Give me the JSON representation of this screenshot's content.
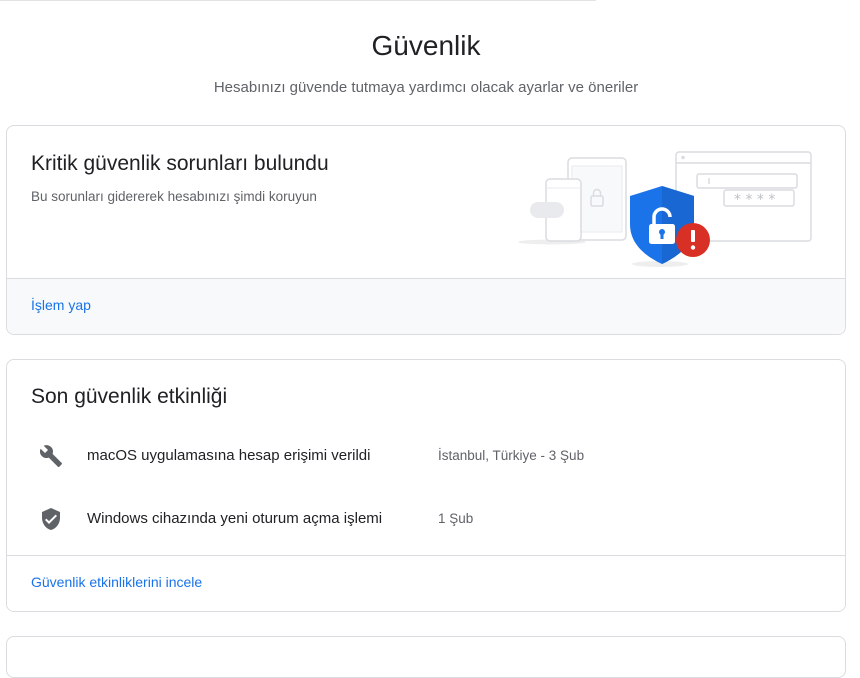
{
  "page": {
    "title": "Güvenlik",
    "subtitle": "Hesabınızı güvende tutmaya yardımcı olacak ayarlar ve öneriler"
  },
  "critical_card": {
    "title": "Kritik güvenlik sorunları bulundu",
    "description": "Bu sorunları gidererek hesabınızı şimdi koruyun",
    "action_link": "İşlem yap",
    "alert_color": "#d93025",
    "shield_color": "#1a73e8"
  },
  "activity_card": {
    "title": "Son güvenlik etkinliği",
    "events": [
      {
        "icon": "wrench-icon",
        "text": "macOS uygulamasına hesap erişimi verildi",
        "meta": "İstanbul, Türkiye - 3 Şub"
      },
      {
        "icon": "shield-check-icon",
        "text": "Windows cihazında yeni oturum açma işlemi",
        "meta": "1 Şub"
      }
    ],
    "review_link": "Güvenlik etkinliklerini incele"
  },
  "colors": {
    "link": "#1a73e8",
    "text": "#202124",
    "secondary": "#5f6368",
    "border": "#dadce0"
  }
}
